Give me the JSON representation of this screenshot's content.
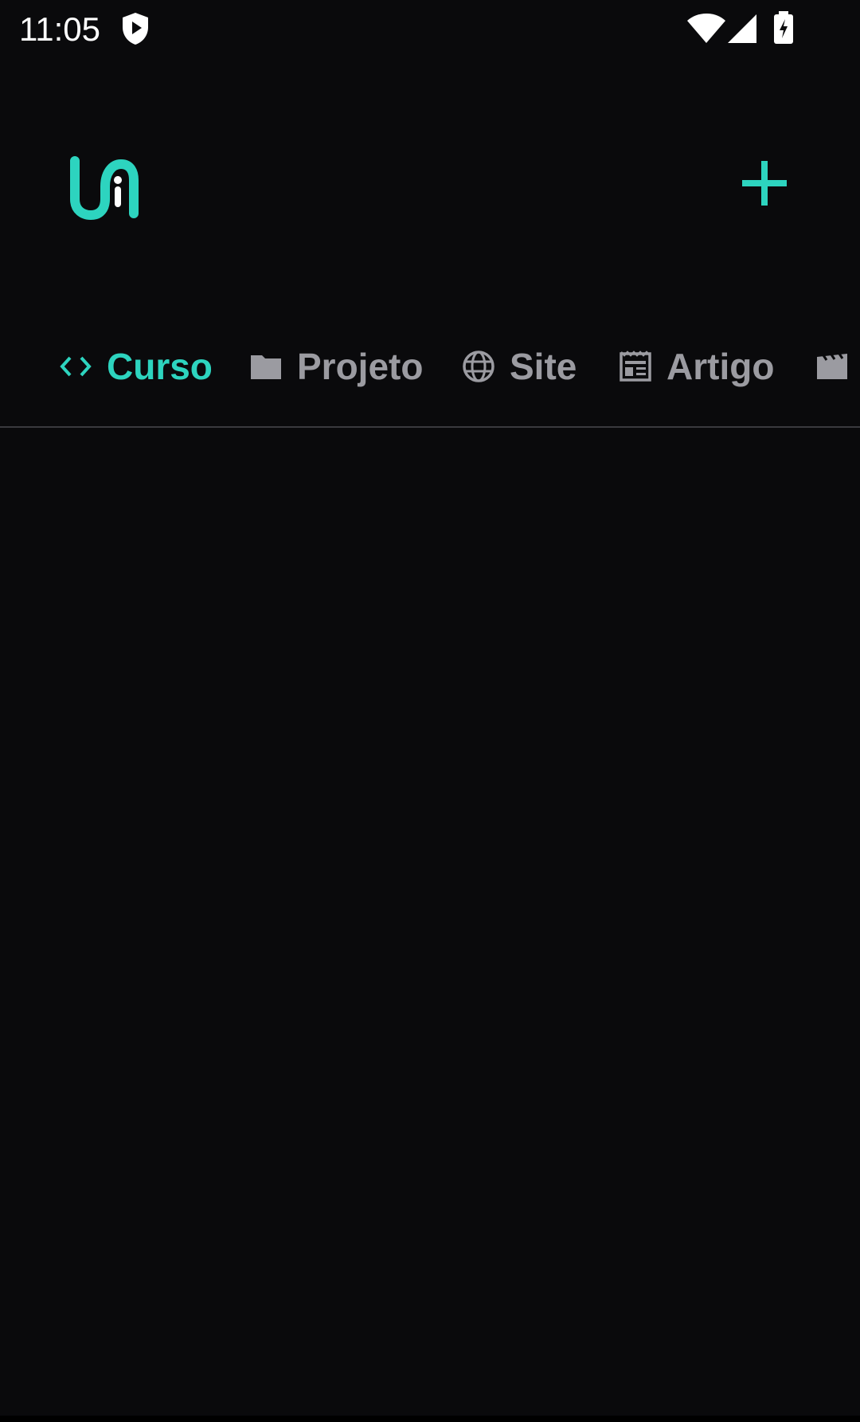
{
  "status_bar": {
    "time": "11:05",
    "icons": [
      "shield-play-icon",
      "wifi-icon",
      "signal-icon",
      "battery-charging-icon"
    ]
  },
  "header": {
    "logo_icon": "app-logo-icon",
    "add_icon": "plus-icon"
  },
  "tabs": [
    {
      "label": "Curso",
      "icon": "code-icon",
      "active": true
    },
    {
      "label": "Projeto",
      "icon": "folder-icon",
      "active": false
    },
    {
      "label": "Site",
      "icon": "globe-icon",
      "active": false
    },
    {
      "label": "Artigo",
      "icon": "newspaper-icon",
      "active": false
    },
    {
      "label": "",
      "icon": "movie-icon",
      "active": false
    }
  ],
  "colors": {
    "accent": "#2dd4bf",
    "background": "#0a0a0c",
    "inactive_tab": "#9b9ba1",
    "divider": "#3a3a3e"
  }
}
